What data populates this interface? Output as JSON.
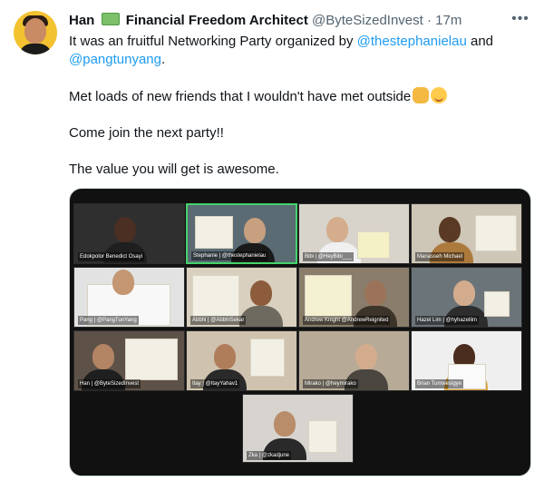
{
  "tweet": {
    "author_name": "Han",
    "author_title": "Financial Freedom Architect",
    "handle": "@ByteSizedInvest",
    "separator": "·",
    "time": "17m",
    "more": "•••",
    "money_icon": "money-emoji-icon",
    "text": {
      "line1_a": "It was an fruitful Networking Party organized by ",
      "mention1": "@thestephanielau",
      "line1_b": " and",
      "mention2": "@pangtunyang",
      "line1_c": ".",
      "line2": "Met loads of new friends that I wouldn't have met outside",
      "line3": "Come join the next party!!",
      "line4": "The value you will get is awesome."
    }
  },
  "participants": [
    "Edokpolor Benedict Osayi",
    "Stephanie | @thestephanielau",
    "Bibi | @HeyBibi___",
    "Manasseh Michael",
    "Pang | @PangTunYang",
    "Abbhi | @AbbhiSekar",
    "Andrew Knight @AndrewReignited",
    "Hazel Lim | @hyhazellim",
    "Han | @ByteSizedInvest",
    "Itay | @ItayYahav1",
    "Mirako | @heymirako",
    "Brian Tumwesigye",
    "Zka | @zkadjune"
  ],
  "colors": {
    "link": "#1d9bf0",
    "muted": "#536471",
    "active_speaker": "#44d36b"
  }
}
